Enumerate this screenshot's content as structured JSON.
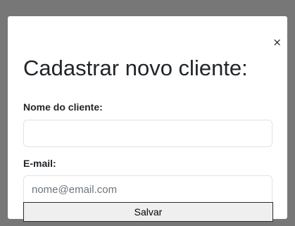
{
  "modal": {
    "title": "Cadastrar novo cliente:",
    "close_label": "×",
    "fields": {
      "name": {
        "label": "Nome do cliente:",
        "value": "",
        "placeholder": ""
      },
      "email": {
        "label": "E-mail:",
        "value": "",
        "placeholder": "nome@email.com"
      }
    },
    "save_label": "Salvar"
  },
  "colors": {
    "backdrop": "#777777",
    "modal_background": "#ffffff",
    "text": "#212529",
    "input_border": "#dfe2e6",
    "button_background": "#efefef"
  },
  "icons": {
    "close": "close-icon"
  }
}
